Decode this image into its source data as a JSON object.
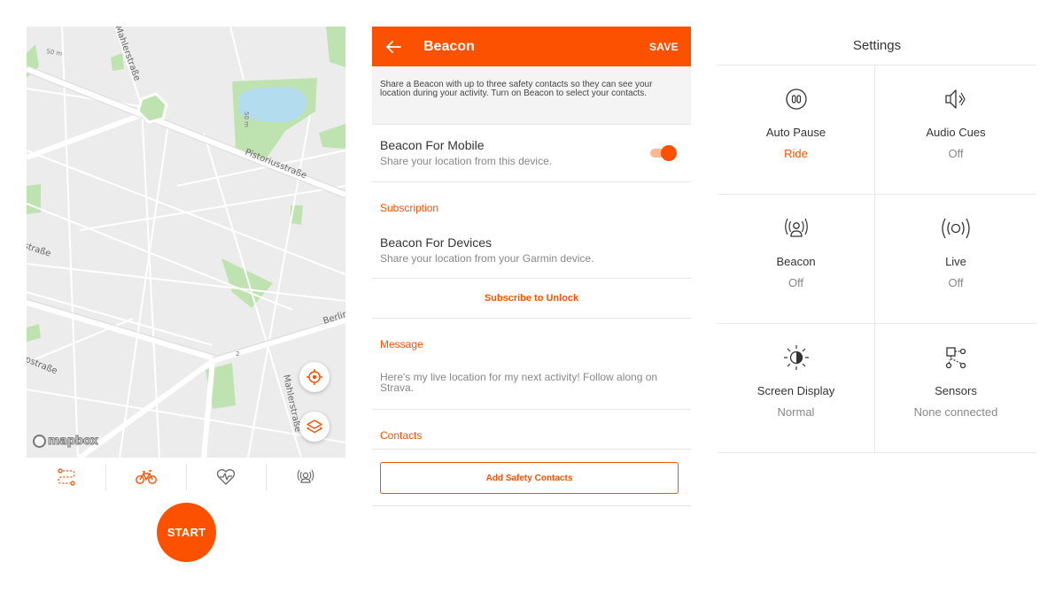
{
  "map": {
    "street_labels": [
      "Pistoriusstraße",
      "Berlin",
      "Mahlerstraße",
      "Mahlerstraße",
      "straße",
      "ерstraße"
    ],
    "small_labels": [
      "50 m",
      "50 m",
      "2"
    ],
    "attribution": "mapbox",
    "locate_icon": "crosshair-icon",
    "layers_icon": "layers-icon"
  },
  "sport_tabs": [
    {
      "icon": "route-icon",
      "active": true
    },
    {
      "icon": "bike-icon",
      "active": true
    },
    {
      "icon": "heart-rate-icon",
      "active": false
    },
    {
      "icon": "beacon-icon",
      "active": false
    }
  ],
  "start_label": "START",
  "beacon": {
    "title": "Beacon",
    "save_label": "SAVE",
    "intro": "Share a Beacon with up to three safety contacts so they can see your location during your activity. Turn on Beacon to select your contacts.",
    "mobile_title": "Beacon For Mobile",
    "mobile_sub": "Share your location from this device.",
    "mobile_enabled": true,
    "subscription_heading": "Subscription",
    "devices_title": "Beacon For Devices",
    "devices_sub": "Share your location from your Garmin device.",
    "subscribe_label": "Subscribe to Unlock",
    "message_heading": "Message",
    "message_text": "Here's my live location for my next activity! Follow along on Strava.",
    "contacts_heading": "Contacts",
    "add_contacts_label": "Add Safety Contacts"
  },
  "settings": {
    "title": "Settings",
    "items": [
      {
        "label": "Auto Pause",
        "value": "Ride",
        "accent": true,
        "icon": "pause-icon"
      },
      {
        "label": "Audio Cues",
        "value": "Off",
        "accent": false,
        "icon": "speaker-icon"
      },
      {
        "label": "Beacon",
        "value": "Off",
        "accent": false,
        "icon": "beacon-icon"
      },
      {
        "label": "Live",
        "value": "Off",
        "accent": false,
        "icon": "live-icon"
      },
      {
        "label": "Screen Display",
        "value": "Normal",
        "accent": false,
        "icon": "brightness-icon"
      },
      {
        "label": "Sensors",
        "value": "None connected",
        "accent": false,
        "icon": "sensors-icon"
      }
    ]
  },
  "colors": {
    "accent": "#fc5200",
    "accent_light": "#fdb894",
    "map_bg": "#ececec",
    "park": "#bfe3b0",
    "water": "#b3dcef"
  }
}
